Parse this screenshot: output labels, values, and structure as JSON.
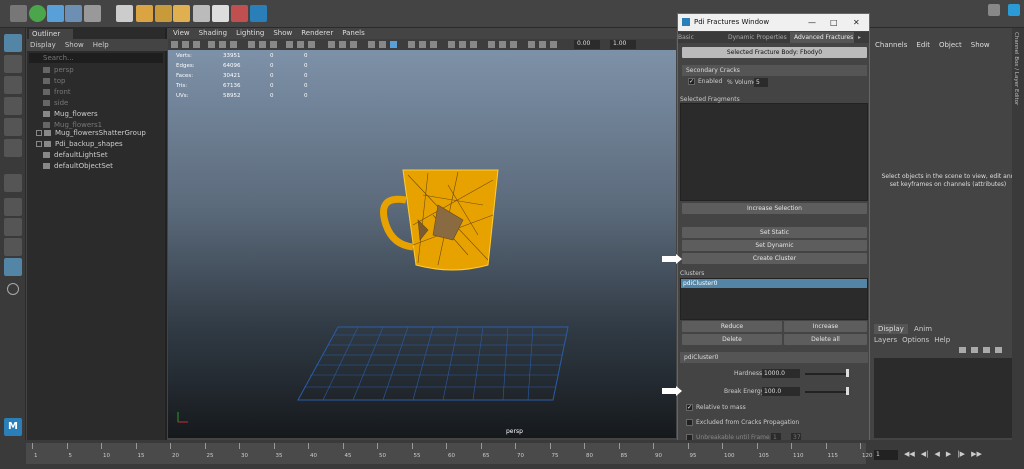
{
  "outliner": {
    "tab": "Outliner",
    "menu": [
      "Display",
      "Show",
      "Help"
    ],
    "search_placeholder": "Search...",
    "items": [
      {
        "label": "persp",
        "dim": true
      },
      {
        "label": "top",
        "dim": true
      },
      {
        "label": "front",
        "dim": true
      },
      {
        "label": "side",
        "dim": true
      },
      {
        "label": "Mug_flowers",
        "dim": false
      },
      {
        "label": "Mug_flowers1",
        "dim": true
      },
      {
        "label": "Mug_flowersShatterGroup",
        "dim": false
      },
      {
        "label": "Pdi_backup_shapes",
        "dim": false
      },
      {
        "label": "defaultLightSet",
        "dim": false
      },
      {
        "label": "defaultObjectSet",
        "dim": false
      }
    ]
  },
  "viewport": {
    "menu": [
      "View",
      "Shading",
      "Lighting",
      "Show",
      "Renderer",
      "Panels"
    ],
    "exposure": "0.00",
    "gamma": "1.00",
    "hud": {
      "rows": [
        {
          "label": "Verts:",
          "v1": "33951",
          "v2": "0",
          "v3": "0"
        },
        {
          "label": "Edges:",
          "v1": "64096",
          "v2": "0",
          "v3": "0"
        },
        {
          "label": "Faces:",
          "v1": "30421",
          "v2": "0",
          "v3": "0"
        },
        {
          "label": "Tris:",
          "v1": "67136",
          "v2": "0",
          "v3": "0"
        },
        {
          "label": "UVs:",
          "v1": "58952",
          "v2": "0",
          "v3": "0"
        }
      ]
    },
    "camera_label": "persp"
  },
  "fractures": {
    "title": "Pdi Fractures Window",
    "tabs": [
      "Basic Fractures",
      "Dynamic Properties",
      "Advanced Fractures"
    ],
    "selected_body": "Selected Fracture Body: Fbody0",
    "secondary_cracks": "Secondary Cracks",
    "enabled_label": "Enabled",
    "volume_label": "% Volume",
    "volume_value": "5",
    "selected_fragments": "Selected Fragments",
    "increase_selection": "Increase Selection",
    "set_static": "Set Static",
    "set_dynamic": "Set Dynamic",
    "create_cluster": "Create Cluster",
    "clusters_label": "Clusters",
    "cluster_item": "pdiCluster0",
    "reduce": "Reduce",
    "increase": "Increase",
    "delete": "Delete",
    "delete_all": "Delete all",
    "cluster_section": "pdiCluster0",
    "hardness_label": "Hardness",
    "hardness_value": "1000.0",
    "break_energy_label": "Break Energy",
    "break_energy_value": "100.0",
    "relative_to_mass": "Relative to mass",
    "excluded_label": "Excluded from Cracks Propagation",
    "unbreakable_label": "Unbreakable until Frame",
    "unbreakable_value": "1",
    "unbreakable_frame": "37"
  },
  "channel_box": {
    "menu": [
      "Channels",
      "Edit",
      "Object",
      "Show"
    ],
    "message": "Select objects in the scene to view, edit and set keyframes on channels (attributes)",
    "layer_tabs": [
      "Display",
      "Anim"
    ],
    "layer_menu": [
      "Layers",
      "Options",
      "Help"
    ]
  },
  "side_strip": "Channel Box / Layer Editor",
  "timeline": {
    "ticks": [
      "1",
      "5",
      "10",
      "15",
      "20",
      "25",
      "30",
      "35",
      "40",
      "45",
      "50",
      "55",
      "60",
      "65",
      "70",
      "75",
      "80",
      "85",
      "90",
      "95",
      "100",
      "105",
      "110",
      "115",
      "120"
    ],
    "current_frame": "1"
  },
  "colors": {
    "accent": "#5285a6",
    "mug": "#f0a800",
    "grid": "#2a5ca8"
  }
}
